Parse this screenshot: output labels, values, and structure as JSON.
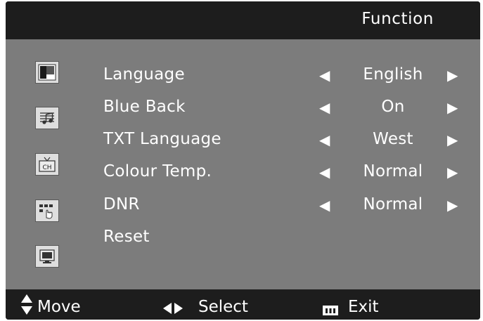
{
  "header": {
    "title": "Function"
  },
  "sidebar": {
    "icons": [
      "picture-icon",
      "sound-icon",
      "channel-icon",
      "function-icon",
      "pc-monitor-icon"
    ]
  },
  "menu": {
    "items": [
      {
        "label": "Language",
        "value": "English"
      },
      {
        "label": "Blue Back",
        "value": "On"
      },
      {
        "label": "TXT Language",
        "value": "West"
      },
      {
        "label": "Colour Temp.",
        "value": "Normal"
      },
      {
        "label": "DNR",
        "value": "Normal"
      },
      {
        "label": "Reset",
        "value": ""
      }
    ]
  },
  "footer": {
    "move_label": "Move",
    "select_label": "Select",
    "exit_label": "Exit",
    "move_icon": "up-down-arrows-icon",
    "select_icon": "left-right-arrows-icon",
    "exit_icon": "menu-key-icon"
  },
  "colors": {
    "osd_background": "#1d1d1d",
    "panel_background": "#7c7c7c",
    "text": "#ffffff"
  }
}
